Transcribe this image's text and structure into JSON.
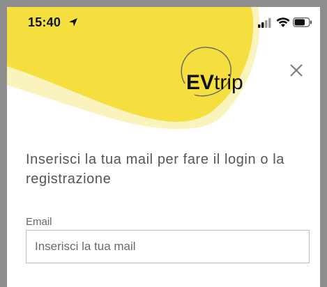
{
  "status_bar": {
    "time": "15:40",
    "location_icon": "location-arrow-icon",
    "signal_icon": "cellular-signal-icon",
    "wifi_icon": "wifi-icon",
    "battery_icon": "battery-icon"
  },
  "header": {
    "logo_bold": "EV",
    "logo_regular": "trip",
    "close_icon": "close-icon"
  },
  "login": {
    "intro": "Inserisci la tua mail per fare il login o la registrazione",
    "email_label": "Email",
    "email_placeholder": "Inserisci la tua mail",
    "email_value": ""
  },
  "colors": {
    "brand_yellow": "#f4df3f",
    "light_yellow": "#fbf3be",
    "frame_gray": "#8e8e8e"
  }
}
